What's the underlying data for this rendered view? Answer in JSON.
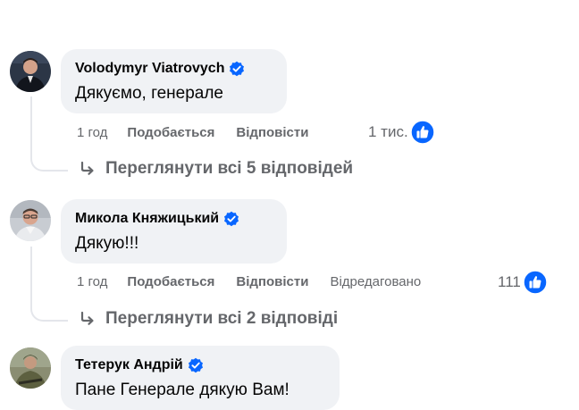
{
  "comments": [
    {
      "author": "Volodymyr Viatrovych",
      "text": "Дякуємо, генерале",
      "time": "1 год",
      "like_label": "Подобається",
      "reply_label": "Відповісти",
      "edited": "",
      "reactions": "1 тис.",
      "view_replies": "Переглянути всі 5 відповідей"
    },
    {
      "author": "Микола Княжицький",
      "text": "Дякую!!!",
      "time": "1 год",
      "like_label": "Подобається",
      "reply_label": "Відповісти",
      "edited": "Відредаговано",
      "reactions": "111",
      "view_replies": "Переглянути всі 2 відповіді"
    },
    {
      "author": "Тетерук Андрій",
      "text": "Пане Генерале дякую Вам!"
    }
  ],
  "colors": {
    "bubble": "#f0f2f5",
    "meta_text": "#65676b",
    "verified": "#0866ff",
    "like": "#0866ff",
    "thread_line": "#e4e6eb"
  },
  "icons": [
    "verified-badge-icon",
    "like-thumb-icon",
    "reply-arrow-icon"
  ]
}
